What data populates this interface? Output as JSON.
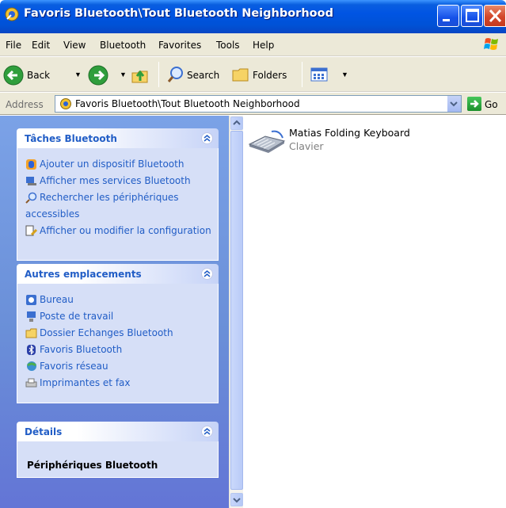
{
  "window": {
    "title": "Favoris Bluetooth\\Tout Bluetooth Neighborhood",
    "title_icon": "bluetooth-favorites-icon"
  },
  "menu": {
    "items": [
      "File",
      "Edit",
      "View",
      "Bluetooth",
      "Favorites",
      "Tools",
      "Help"
    ]
  },
  "toolbar": {
    "back_label": "Back",
    "search_label": "Search",
    "folders_label": "Folders"
  },
  "address": {
    "label": "Address",
    "value": "Favoris Bluetooth\\Tout Bluetooth Neighborhood",
    "go_label": "Go"
  },
  "taskpane": {
    "tasks": {
      "title": "Tâches Bluetooth",
      "items": [
        {
          "label": "Ajouter un dispositif Bluetooth",
          "icon": "add-device-icon"
        },
        {
          "label": "Afficher mes services Bluetooth",
          "icon": "services-icon"
        },
        {
          "label": "Rechercher les périphériques",
          "label2": "accessibles",
          "icon": "search-icon"
        },
        {
          "label": "Afficher ou modifier la configuration",
          "icon": "configuration-icon"
        }
      ]
    },
    "places": {
      "title": "Autres emplacements",
      "items": [
        {
          "label": "Bureau",
          "icon": "desktop-icon"
        },
        {
          "label": "Poste de travail",
          "icon": "my-computer-icon"
        },
        {
          "label": "Dossier Echanges Bluetooth",
          "icon": "folder-icon"
        },
        {
          "label": "Favoris Bluetooth",
          "icon": "bluetooth-icon"
        },
        {
          "label": "Favoris réseau",
          "icon": "network-places-icon"
        },
        {
          "label": "Imprimantes et fax",
          "icon": "printers-icon"
        }
      ]
    },
    "details": {
      "title": "Détails",
      "text": "Périphériques Bluetooth"
    }
  },
  "main": {
    "items": [
      {
        "name": "Matias Folding Keyboard",
        "type": "Clavier",
        "icon": "keyboard-icon"
      }
    ]
  },
  "colors": {
    "titlebar": "#0054e3",
    "taskpane_bg": "#6a8fd8",
    "link": "#215dc6",
    "panel_body": "#d6dff7"
  }
}
